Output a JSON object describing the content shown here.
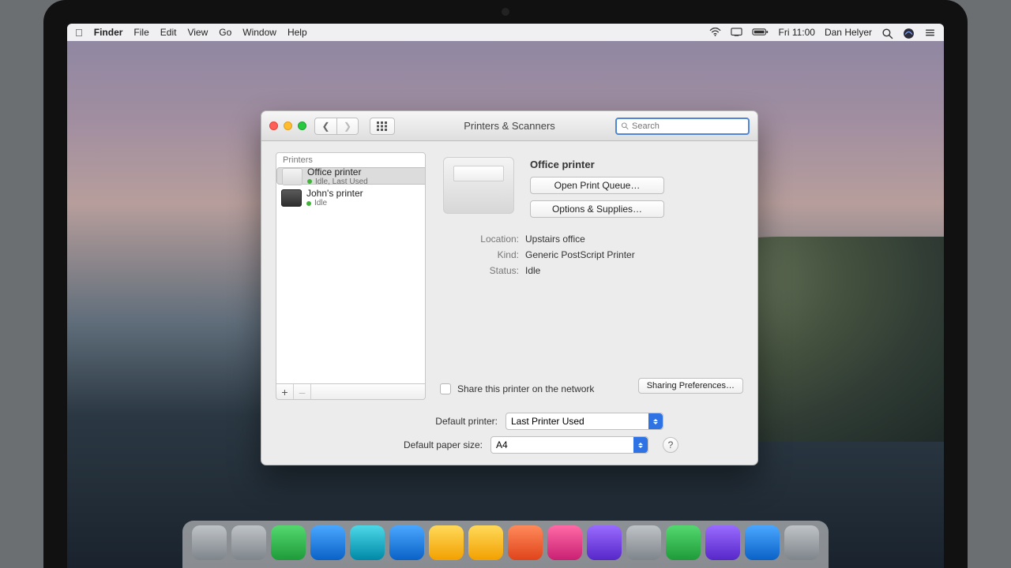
{
  "menubar": {
    "app": "Finder",
    "items": [
      "File",
      "Edit",
      "View",
      "Go",
      "Window",
      "Help"
    ],
    "time": "Fri 11:00",
    "user": "Dan Helyer"
  },
  "window": {
    "title": "Printers & Scanners",
    "search_placeholder": "Search"
  },
  "sidebar": {
    "header": "Printers",
    "printers": [
      {
        "name": "Office printer",
        "status": "Idle, Last Used",
        "selected": true,
        "kind": "laser"
      },
      {
        "name": "John's printer",
        "status": "Idle",
        "selected": false,
        "kind": "mfp"
      }
    ],
    "add": "+",
    "remove": "–"
  },
  "detail": {
    "title": "Office printer",
    "open_queue": "Open Print Queue…",
    "options": "Options & Supplies…",
    "location_label": "Location:",
    "location": "Upstairs office",
    "kind_label": "Kind:",
    "kind": "Generic PostScript Printer",
    "status_label": "Status:",
    "status": "Idle",
    "share_label": "Share this printer on the network",
    "share_prefs": "Sharing Preferences…"
  },
  "defaults": {
    "printer_label": "Default printer:",
    "printer_value": "Last Printer Used",
    "paper_label": "Default paper size:",
    "paper_value": "A4",
    "help": "?"
  }
}
